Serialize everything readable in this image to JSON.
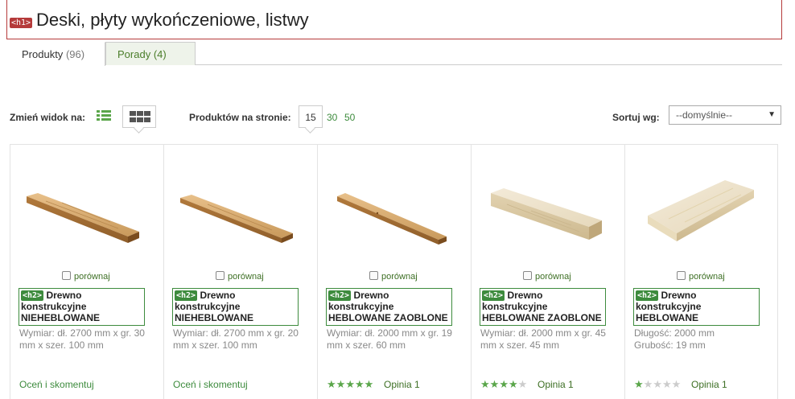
{
  "header": {
    "tag": "<h1>",
    "title": "Deski, płyty wykończeniowe, listwy"
  },
  "tabs": [
    {
      "label": "Produkty",
      "count": "(96)"
    },
    {
      "label": "Porady",
      "count": "(4)"
    }
  ],
  "toolbar": {
    "view_label": "Zmień widok na:",
    "per_page_label": "Produktów na stronie:",
    "per_page_options": [
      "15",
      "30",
      "50"
    ],
    "sort_label": "Sortuj wg:",
    "sort_value": "--domyślnie--"
  },
  "colors": {
    "accent": "#3d8b3d",
    "h1_tag": "#b53a3a",
    "star_on": "#5aa64a",
    "star_off": "#cccccc"
  },
  "products": [
    {
      "compare_label": "porównaj",
      "tag": "<h2>",
      "title_lines": [
        "Drewno",
        "konstrukcyjne",
        "NIEHEBLOWANE"
      ],
      "desc_lines": [
        "Wymiar: dł. 2700 mm x gr. 30",
        "mm x szer. 100 mm"
      ],
      "rate_link": "Oceń i skomentuj",
      "rating": null,
      "opinion": ""
    },
    {
      "compare_label": "porównaj",
      "tag": "<h2>",
      "title_lines": [
        "Drewno",
        "konstrukcyjne",
        "NIEHEBLOWANE"
      ],
      "desc_lines": [
        "Wymiar: dł. 2700 mm x gr. 20",
        "mm x szer. 100 mm"
      ],
      "rate_link": "Oceń i skomentuj",
      "rating": null,
      "opinion": ""
    },
    {
      "compare_label": "porównaj",
      "tag": "<h2>",
      "title_lines": [
        "Drewno",
        "konstrukcyjne",
        "HEBLOWANE ZAOBLONE"
      ],
      "desc_lines": [
        "Wymiar: dł. 2000 mm x gr. 19",
        "mm x szer. 60 mm"
      ],
      "rate_link": "",
      "rating": 5,
      "opinion": "Opinia 1"
    },
    {
      "compare_label": "porównaj",
      "tag": "<h2>",
      "title_lines": [
        "Drewno",
        "konstrukcyjne",
        "HEBLOWANE ZAOBLONE"
      ],
      "desc_lines": [
        "Wymiar: dł. 2000 mm x gr. 45",
        "mm x szer. 45 mm"
      ],
      "rate_link": "",
      "rating": 4,
      "opinion": "Opinia 1"
    },
    {
      "compare_label": "porównaj",
      "tag": "<h2>",
      "title_lines": [
        "Drewno",
        "konstrukcyjne",
        "HEBLOWANE"
      ],
      "desc_lines": [
        "Długość: 2000 mm",
        "Grubość: 19 mm"
      ],
      "rate_link": "",
      "rating": 1,
      "opinion": "Opinia 1"
    }
  ]
}
